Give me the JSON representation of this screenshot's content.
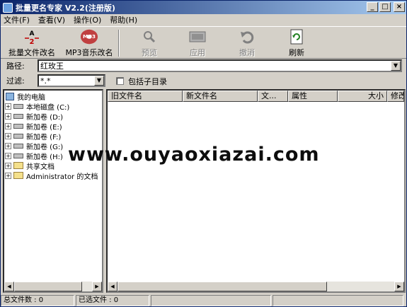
{
  "window": {
    "title": "批量更名专家 V2.2(注册版)",
    "minimize": "_",
    "maximize": "□",
    "close": "×"
  },
  "menu": [
    "文件(F)",
    "查看(V)",
    "操作(O)",
    "帮助(H)"
  ],
  "toolbar": {
    "batch_rename": "批量文件改名",
    "mp3_rename": "MP3音乐改名",
    "mp3_logo": "MP3",
    "preview": "预览",
    "apply": "应用",
    "undo": "撤消",
    "refresh": "刷新"
  },
  "path": {
    "label": "路径:",
    "value": "红玫王"
  },
  "filter": {
    "label": "过滤:",
    "value": "*.*",
    "subdir_label": "包括子目录"
  },
  "tree": [
    {
      "label": "我的电脑",
      "type": "pc"
    },
    {
      "label": "本地磁盘 (C:)",
      "type": "drive"
    },
    {
      "label": "新加卷 (D:)",
      "type": "drive"
    },
    {
      "label": "新加卷 (E:)",
      "type": "drive"
    },
    {
      "label": "新加卷 (F:)",
      "type": "drive"
    },
    {
      "label": "新加卷 (G:)",
      "type": "drive"
    },
    {
      "label": "新加卷 (H:)",
      "type": "drive"
    },
    {
      "label": "共享文档",
      "type": "folder"
    },
    {
      "label": "Administrator 的文档",
      "type": "folder"
    }
  ],
  "columns": [
    "旧文件名",
    "新文件名",
    "文...",
    "属性",
    "大小",
    "修改"
  ],
  "status": {
    "total_files": "总文件数 : 0",
    "selected_files": "已选文件 : 0"
  },
  "watermark": "www.ouyaoxiazai.com",
  "colors": {
    "title_start": "#0a246a",
    "title_end": "#a6caf0",
    "face": "#d4d0c8"
  }
}
